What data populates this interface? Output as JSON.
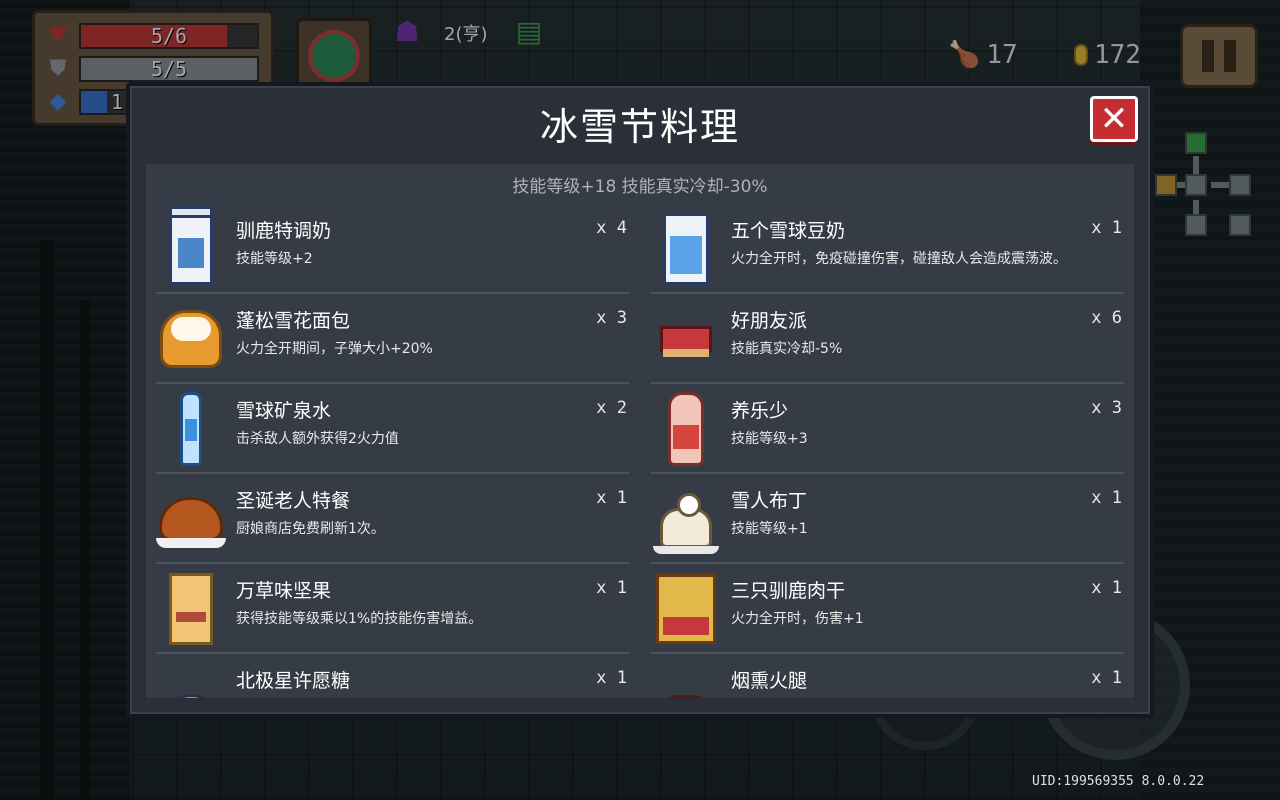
{
  "hud": {
    "health": "5/6",
    "health_fraction": 0.83,
    "armor": "5/5",
    "armor_fraction": 1.0,
    "energy": "1",
    "energy_fraction": 0.15,
    "buff_text": "2(亨)",
    "food": "17",
    "coins": "172"
  },
  "modal": {
    "title": "冰雪节料理",
    "close": "✕",
    "summary": "技能等级+18 技能真实冷却-30%",
    "items": [
      {
        "name": "驯鹿特调奶",
        "desc": "技能等级+2",
        "qty": "x 4",
        "icon": "milk-carton-icon"
      },
      {
        "name": "五个雪球豆奶",
        "desc": "火力全开时，免疫碰撞伤害，碰撞敌人会造成震荡波。",
        "qty": "x 1",
        "icon": "soy-milk-icon"
      },
      {
        "name": "蓬松雪花面包",
        "desc": "火力全开期间，子弹大小+20%",
        "qty": "x 3",
        "icon": "bread-icon"
      },
      {
        "name": "好朋友派",
        "desc": "技能真实冷却-5%",
        "qty": "x 6",
        "icon": "pie-icon"
      },
      {
        "name": "雪球矿泉水",
        "desc": "击杀敌人额外获得2火力值",
        "qty": "x 2",
        "icon": "water-bottle-icon"
      },
      {
        "name": "养乐少",
        "desc": "技能等级+3",
        "qty": "x 3",
        "icon": "yogurt-drink-icon"
      },
      {
        "name": "圣诞老人特餐",
        "desc": "厨娘商店免费刷新1次。",
        "qty": "x 1",
        "icon": "roast-turkey-icon"
      },
      {
        "name": "雪人布丁",
        "desc": "技能等级+1",
        "qty": "x 1",
        "icon": "snowman-pudding-icon"
      },
      {
        "name": "万草味坚果",
        "desc": "获得技能等级乘以1%的技能伤害增益。",
        "qty": "x 1",
        "icon": "nuts-jar-icon"
      },
      {
        "name": "三只驯鹿肉干",
        "desc": "火力全开时，伤害+1",
        "qty": "x 1",
        "icon": "jerky-bag-icon"
      },
      {
        "name": "北极星许愿糖",
        "desc": "",
        "qty": "x 1",
        "icon": "wish-candy-icon"
      },
      {
        "name": "烟熏火腿",
        "desc": "",
        "qty": "x 1",
        "icon": "smoked-ham-icon"
      }
    ]
  },
  "footer": {
    "uid": "UID:199569355 8.0.0.22"
  },
  "colors": {
    "health": "#c23a3a",
    "armor": "#8e949c",
    "energy": "#3a74d1",
    "close_button": "#c62d30",
    "panel_bg": "#363c45"
  }
}
